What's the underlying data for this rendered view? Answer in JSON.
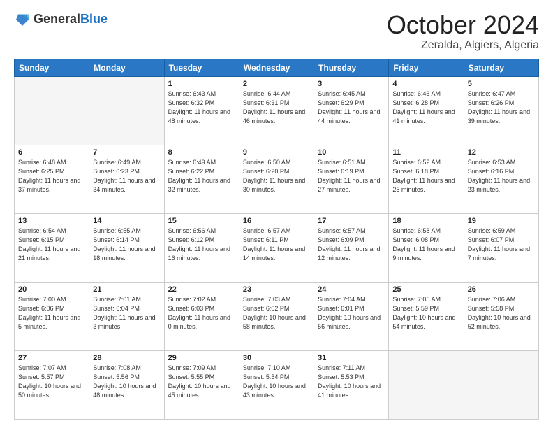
{
  "header": {
    "logo": {
      "general": "General",
      "blue": "Blue"
    },
    "title": "October 2024",
    "location": "Zeralda, Algiers, Algeria"
  },
  "weekdays": [
    "Sunday",
    "Monday",
    "Tuesday",
    "Wednesday",
    "Thursday",
    "Friday",
    "Saturday"
  ],
  "weeks": [
    [
      {
        "day": "",
        "empty": true
      },
      {
        "day": "",
        "empty": true
      },
      {
        "day": "1",
        "sunrise": "Sunrise: 6:43 AM",
        "sunset": "Sunset: 6:32 PM",
        "daylight": "Daylight: 11 hours and 48 minutes."
      },
      {
        "day": "2",
        "sunrise": "Sunrise: 6:44 AM",
        "sunset": "Sunset: 6:31 PM",
        "daylight": "Daylight: 11 hours and 46 minutes."
      },
      {
        "day": "3",
        "sunrise": "Sunrise: 6:45 AM",
        "sunset": "Sunset: 6:29 PM",
        "daylight": "Daylight: 11 hours and 44 minutes."
      },
      {
        "day": "4",
        "sunrise": "Sunrise: 6:46 AM",
        "sunset": "Sunset: 6:28 PM",
        "daylight": "Daylight: 11 hours and 41 minutes."
      },
      {
        "day": "5",
        "sunrise": "Sunrise: 6:47 AM",
        "sunset": "Sunset: 6:26 PM",
        "daylight": "Daylight: 11 hours and 39 minutes."
      }
    ],
    [
      {
        "day": "6",
        "sunrise": "Sunrise: 6:48 AM",
        "sunset": "Sunset: 6:25 PM",
        "daylight": "Daylight: 11 hours and 37 minutes."
      },
      {
        "day": "7",
        "sunrise": "Sunrise: 6:49 AM",
        "sunset": "Sunset: 6:23 PM",
        "daylight": "Daylight: 11 hours and 34 minutes."
      },
      {
        "day": "8",
        "sunrise": "Sunrise: 6:49 AM",
        "sunset": "Sunset: 6:22 PM",
        "daylight": "Daylight: 11 hours and 32 minutes."
      },
      {
        "day": "9",
        "sunrise": "Sunrise: 6:50 AM",
        "sunset": "Sunset: 6:20 PM",
        "daylight": "Daylight: 11 hours and 30 minutes."
      },
      {
        "day": "10",
        "sunrise": "Sunrise: 6:51 AM",
        "sunset": "Sunset: 6:19 PM",
        "daylight": "Daylight: 11 hours and 27 minutes."
      },
      {
        "day": "11",
        "sunrise": "Sunrise: 6:52 AM",
        "sunset": "Sunset: 6:18 PM",
        "daylight": "Daylight: 11 hours and 25 minutes."
      },
      {
        "day": "12",
        "sunrise": "Sunrise: 6:53 AM",
        "sunset": "Sunset: 6:16 PM",
        "daylight": "Daylight: 11 hours and 23 minutes."
      }
    ],
    [
      {
        "day": "13",
        "sunrise": "Sunrise: 6:54 AM",
        "sunset": "Sunset: 6:15 PM",
        "daylight": "Daylight: 11 hours and 21 minutes."
      },
      {
        "day": "14",
        "sunrise": "Sunrise: 6:55 AM",
        "sunset": "Sunset: 6:14 PM",
        "daylight": "Daylight: 11 hours and 18 minutes."
      },
      {
        "day": "15",
        "sunrise": "Sunrise: 6:56 AM",
        "sunset": "Sunset: 6:12 PM",
        "daylight": "Daylight: 11 hours and 16 minutes."
      },
      {
        "day": "16",
        "sunrise": "Sunrise: 6:57 AM",
        "sunset": "Sunset: 6:11 PM",
        "daylight": "Daylight: 11 hours and 14 minutes."
      },
      {
        "day": "17",
        "sunrise": "Sunrise: 6:57 AM",
        "sunset": "Sunset: 6:09 PM",
        "daylight": "Daylight: 11 hours and 12 minutes."
      },
      {
        "day": "18",
        "sunrise": "Sunrise: 6:58 AM",
        "sunset": "Sunset: 6:08 PM",
        "daylight": "Daylight: 11 hours and 9 minutes."
      },
      {
        "day": "19",
        "sunrise": "Sunrise: 6:59 AM",
        "sunset": "Sunset: 6:07 PM",
        "daylight": "Daylight: 11 hours and 7 minutes."
      }
    ],
    [
      {
        "day": "20",
        "sunrise": "Sunrise: 7:00 AM",
        "sunset": "Sunset: 6:06 PM",
        "daylight": "Daylight: 11 hours and 5 minutes."
      },
      {
        "day": "21",
        "sunrise": "Sunrise: 7:01 AM",
        "sunset": "Sunset: 6:04 PM",
        "daylight": "Daylight: 11 hours and 3 minutes."
      },
      {
        "day": "22",
        "sunrise": "Sunrise: 7:02 AM",
        "sunset": "Sunset: 6:03 PM",
        "daylight": "Daylight: 11 hours and 0 minutes."
      },
      {
        "day": "23",
        "sunrise": "Sunrise: 7:03 AM",
        "sunset": "Sunset: 6:02 PM",
        "daylight": "Daylight: 10 hours and 58 minutes."
      },
      {
        "day": "24",
        "sunrise": "Sunrise: 7:04 AM",
        "sunset": "Sunset: 6:01 PM",
        "daylight": "Daylight: 10 hours and 56 minutes."
      },
      {
        "day": "25",
        "sunrise": "Sunrise: 7:05 AM",
        "sunset": "Sunset: 5:59 PM",
        "daylight": "Daylight: 10 hours and 54 minutes."
      },
      {
        "day": "26",
        "sunrise": "Sunrise: 7:06 AM",
        "sunset": "Sunset: 5:58 PM",
        "daylight": "Daylight: 10 hours and 52 minutes."
      }
    ],
    [
      {
        "day": "27",
        "sunrise": "Sunrise: 7:07 AM",
        "sunset": "Sunset: 5:57 PM",
        "daylight": "Daylight: 10 hours and 50 minutes."
      },
      {
        "day": "28",
        "sunrise": "Sunrise: 7:08 AM",
        "sunset": "Sunset: 5:56 PM",
        "daylight": "Daylight: 10 hours and 48 minutes."
      },
      {
        "day": "29",
        "sunrise": "Sunrise: 7:09 AM",
        "sunset": "Sunset: 5:55 PM",
        "daylight": "Daylight: 10 hours and 45 minutes."
      },
      {
        "day": "30",
        "sunrise": "Sunrise: 7:10 AM",
        "sunset": "Sunset: 5:54 PM",
        "daylight": "Daylight: 10 hours and 43 minutes."
      },
      {
        "day": "31",
        "sunrise": "Sunrise: 7:11 AM",
        "sunset": "Sunset: 5:53 PM",
        "daylight": "Daylight: 10 hours and 41 minutes."
      },
      {
        "day": "",
        "empty": true
      },
      {
        "day": "",
        "empty": true
      }
    ]
  ]
}
